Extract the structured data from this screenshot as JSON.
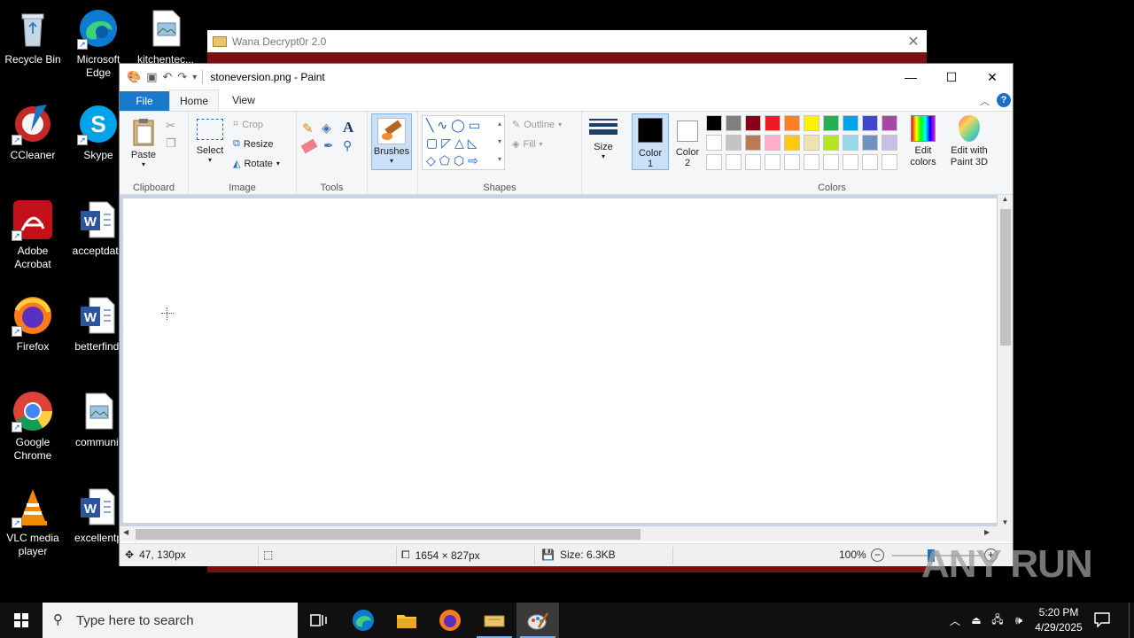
{
  "desktop": {
    "icons": [
      {
        "label": "Recycle Bin"
      },
      {
        "label": "Microsoft Edge"
      },
      {
        "label": "kitchentec..."
      },
      {
        "label": "CCleaner"
      },
      {
        "label": "Skype"
      },
      {
        "label": "Adobe Acrobat"
      },
      {
        "label": "acceptdate"
      },
      {
        "label": "Firefox"
      },
      {
        "label": "betterfind."
      },
      {
        "label": "Google Chrome"
      },
      {
        "label": "communit"
      },
      {
        "label": "VLC media player"
      },
      {
        "label": "excellentp"
      }
    ]
  },
  "wana": {
    "title": "Wana Decrypt0r 2.0"
  },
  "paint": {
    "title": "stoneversion.png - Paint",
    "tabs": {
      "file": "File",
      "home": "Home",
      "view": "View"
    },
    "clipboard": {
      "paste": "Paste",
      "group": "Clipboard"
    },
    "image": {
      "select": "Select",
      "crop": "Crop",
      "resize": "Resize",
      "rotate": "Rotate",
      "group": "Image"
    },
    "tools": {
      "group": "Tools"
    },
    "brushes": {
      "label": "Brushes"
    },
    "shapes": {
      "outline": "Outline",
      "fill": "Fill",
      "group": "Shapes"
    },
    "size": {
      "label": "Size"
    },
    "color1": {
      "label": "Color",
      "num": "1"
    },
    "color2": {
      "label": "Color",
      "num": "2"
    },
    "colors": {
      "group": "Colors",
      "edit": "Edit colors",
      "edit3d": "Edit with Paint 3D"
    },
    "palette_row1": [
      "#000000",
      "#7f7f7f",
      "#880015",
      "#ed1c24",
      "#ff7f27",
      "#fff200",
      "#22b14c",
      "#00a2e8",
      "#3f48cc",
      "#a349a4"
    ],
    "palette_row2": [
      "#ffffff",
      "#c3c3c3",
      "#b97a57",
      "#ffaec9",
      "#ffc90e",
      "#efe4b0",
      "#b5e61d",
      "#99d9ea",
      "#7092be",
      "#c8bfe7"
    ],
    "status": {
      "cursor": "47, 130px",
      "dimensions": "1654 × 827px",
      "size": "Size: 6.3KB",
      "zoom": "100%"
    }
  },
  "taskbar": {
    "search_placeholder": "Type here to search",
    "time": "5:20 PM",
    "date": "4/29/2025"
  },
  "watermark": "ANY RUN"
}
